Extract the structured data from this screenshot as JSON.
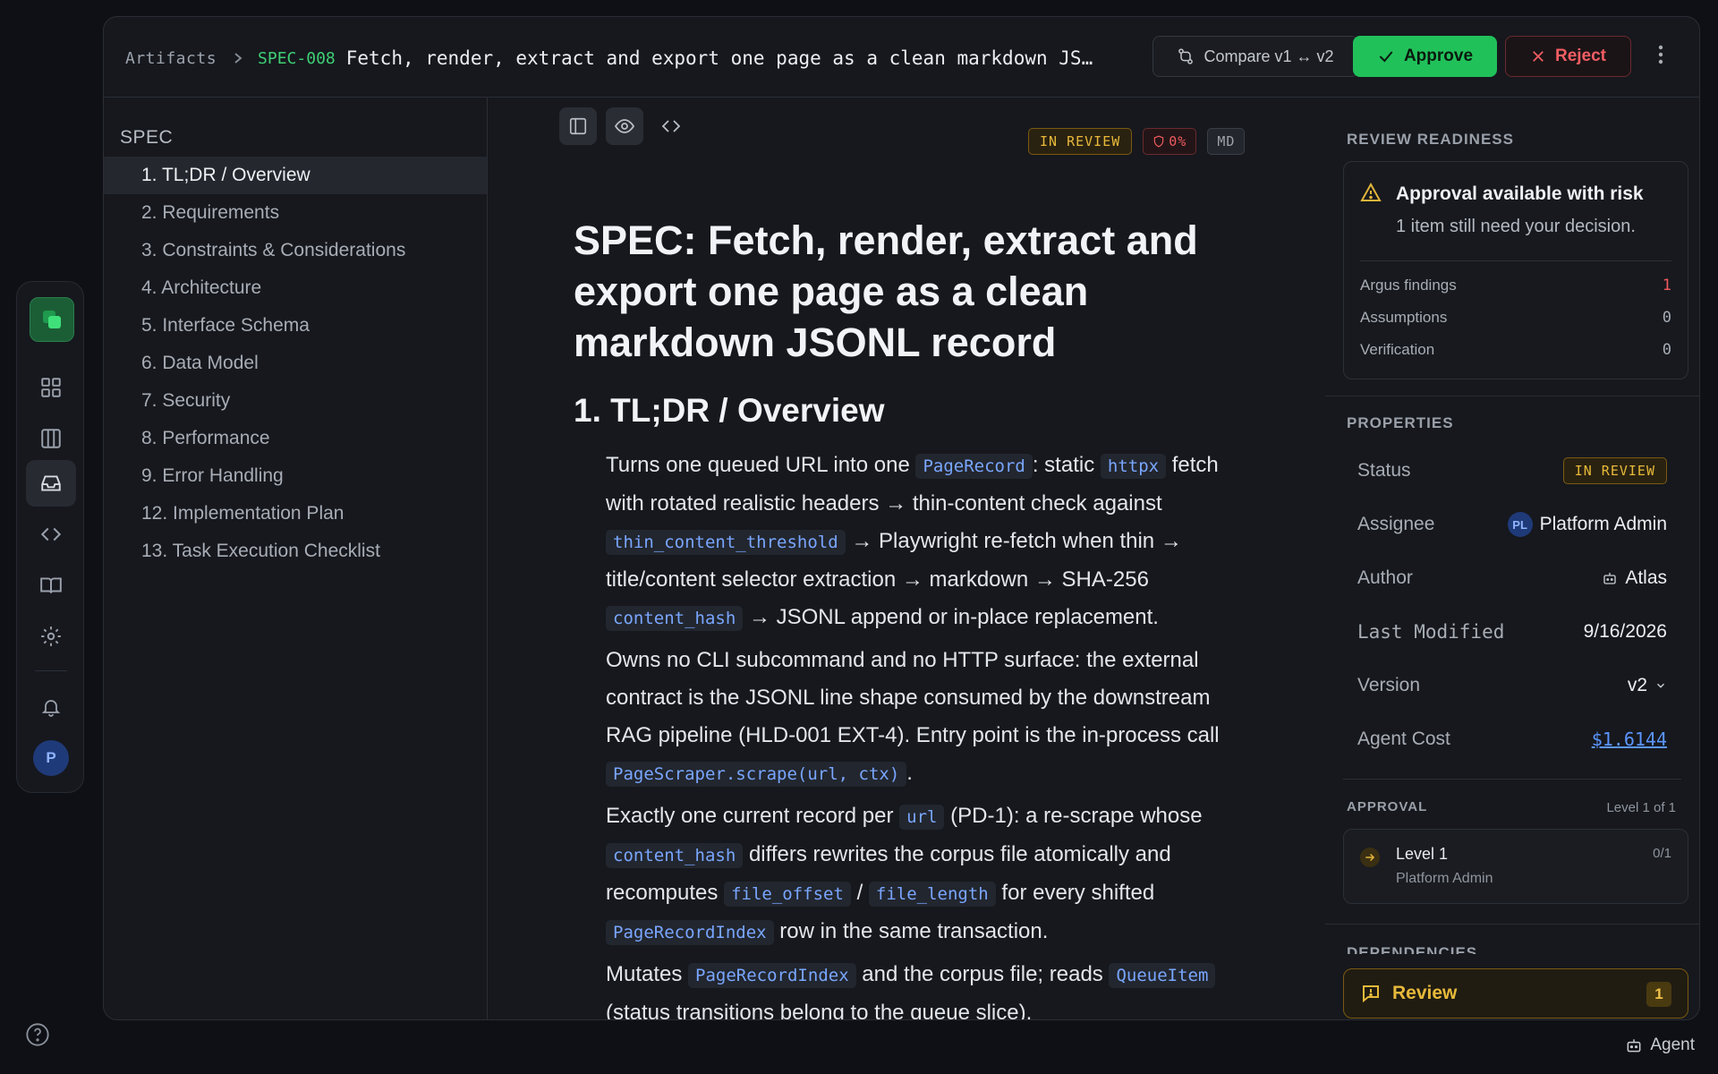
{
  "breadcrumb": {
    "root": "Artifacts",
    "id": "SPEC-008",
    "title": "Fetch, render, extract and export one page as a clean markdown JSONL record"
  },
  "toolbar": {
    "compare_label": "Compare v1 ↔ v2",
    "approve_label": "Approve",
    "reject_label": "Reject"
  },
  "toc": {
    "heading": "SPEC",
    "items": [
      "1. TL;DR / Overview",
      "2. Requirements",
      "3. Constraints & Considerations",
      "4. Architecture",
      "5. Interface Schema",
      "6. Data Model",
      "7. Security",
      "8. Performance",
      "9. Error Handling",
      "12. Implementation Plan",
      "13. Task Execution Checklist"
    ]
  },
  "doc": {
    "badges": {
      "status": "IN REVIEW",
      "risk": "0%",
      "format": "MD"
    },
    "title": "SPEC: Fetch, render, extract and export one page as a clean markdown JSONL record",
    "section_title": "1. TL;DR / Overview",
    "p1": {
      "t1": "Turns one queued URL into one ",
      "c1": "PageRecord",
      "t2": ": static ",
      "c2": "httpx",
      "t3": " fetch with rotated realistic headers → thin-content check against ",
      "c3": "thin_content_threshold",
      "t4": " → Playwright re-fetch when thin → title/content selector extraction → markdown → SHA-256 ",
      "c4": "content_hash",
      "t5": " → JSONL append or in-place replacement."
    },
    "p2": {
      "t1": "Owns no CLI subcommand and no HTTP surface: the external contract is the JSONL line shape consumed by the downstream RAG pipeline (HLD-001 EXT-4). Entry point is the in-process call ",
      "c1": "PageScraper.scrape(url, ctx)",
      "t2": "."
    },
    "p3": {
      "t1": "Exactly one current record per ",
      "c1": "url",
      "t2": " (PD-1): a re-scrape whose ",
      "c2": "content_hash",
      "t3": " differs rewrites the corpus file atomically and recomputes ",
      "c3": "file_offset",
      "t4": " / ",
      "c4": "file_length",
      "t5": " for every shifted ",
      "c5": "PageRecordIndex",
      "t6": " row in the same transaction."
    },
    "p4": {
      "t1": "Mutates ",
      "c1": "PageRecordIndex",
      "t2": " and the corpus file; reads ",
      "c2": "QueueItem",
      "t3": " (status transitions belong to the queue slice)."
    }
  },
  "readiness": {
    "section": "REVIEW READINESS",
    "heading": "Approval available with risk",
    "subtitle": "1 item still need your decision.",
    "rows": [
      {
        "label": "Argus findings",
        "value": "1",
        "color": "#ef5a5f"
      },
      {
        "label": "Assumptions",
        "value": "0",
        "color": "#a8adb5"
      },
      {
        "label": "Verification",
        "value": "0",
        "color": "#a8adb5"
      }
    ]
  },
  "properties": {
    "section": "PROPERTIES",
    "status_label": "Status",
    "status_value": "IN REVIEW",
    "assignee_label": "Assignee",
    "assignee_initials": "PL",
    "assignee_value": "Platform Admin",
    "author_label": "Author",
    "author_value": "Atlas",
    "modified_label": "Last Modified",
    "modified_value": "9/16/2026",
    "version_label": "Version",
    "version_value": "v2",
    "cost_label": "Agent Cost",
    "cost_value": "$1.6144"
  },
  "approval": {
    "section": "APPROVAL",
    "level_summary": "Level 1 of 1",
    "level_name": "Level 1",
    "level_approver": "Platform Admin",
    "level_progress": "0/1"
  },
  "dependencies": {
    "section": "DEPENDENCIES"
  },
  "review_bar": {
    "label": "Review",
    "count": "1"
  },
  "rail": {
    "avatar_initial": "P"
  },
  "footer": {
    "agent_label": "Agent"
  },
  "colors": {
    "accent_green": "#21c15a",
    "danger": "#ef5a5f",
    "warning": "#e7b93a",
    "link": "#5b95ff"
  }
}
